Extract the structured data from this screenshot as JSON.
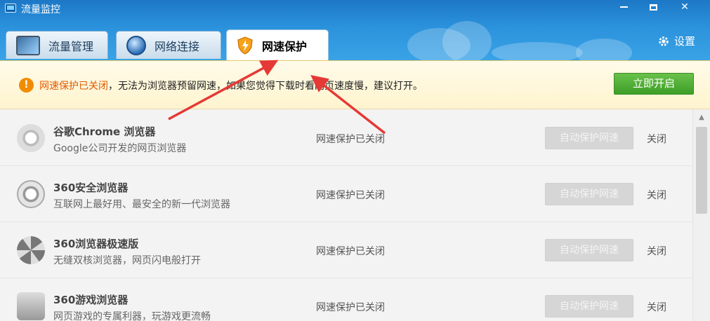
{
  "window": {
    "title": "流量监控",
    "minimize_glyph": "",
    "maximize_glyph": "",
    "close_glyph": "✕"
  },
  "tabs": [
    {
      "label": "流量管理",
      "icon": "monitor-icon",
      "active": false
    },
    {
      "label": "网络连接",
      "icon": "globe-icon",
      "active": false
    },
    {
      "label": "网速保护",
      "icon": "shield-icon",
      "active": true
    }
  ],
  "settings": {
    "label": "设置",
    "icon": "gear-icon"
  },
  "notice": {
    "highlight": "网速保护已关闭",
    "text": "，无法为浏览器预留网速，如果您觉得下载时看网页速度慢，建议打开。",
    "button": "立即开启",
    "icon": "warning-icon"
  },
  "browsers": [
    {
      "name": "谷歌Chrome 浏览器",
      "desc": "Google公司开发的网页浏览器",
      "status": "网速保护已关闭",
      "button": "自动保护网速",
      "action": "关闭",
      "icon": "chrome-icon"
    },
    {
      "name": "360安全浏览器",
      "desc": "互联网上最好用、最安全的新一代浏览器",
      "status": "网速保护已关闭",
      "button": "自动保护网速",
      "action": "关闭",
      "icon": "360se-icon"
    },
    {
      "name": "360浏览器极速版",
      "desc": "无缝双核浏览器，网页闪电般打开",
      "status": "网速保护已关闭",
      "button": "自动保护网速",
      "action": "关闭",
      "icon": "360ee-icon"
    },
    {
      "name": "360游戏浏览器",
      "desc": "网页游戏的专属利器，玩游戏更流畅",
      "status": "网速保护已关闭",
      "button": "自动保护网速",
      "action": "关闭",
      "icon": "game-browser-icon"
    }
  ],
  "colors": {
    "header_blue": "#2b92dc",
    "warning_orange": "#f08c00",
    "highlight_text": "#e05a00",
    "open_button_green": "#4caf30",
    "annotation_red": "#e53935"
  }
}
